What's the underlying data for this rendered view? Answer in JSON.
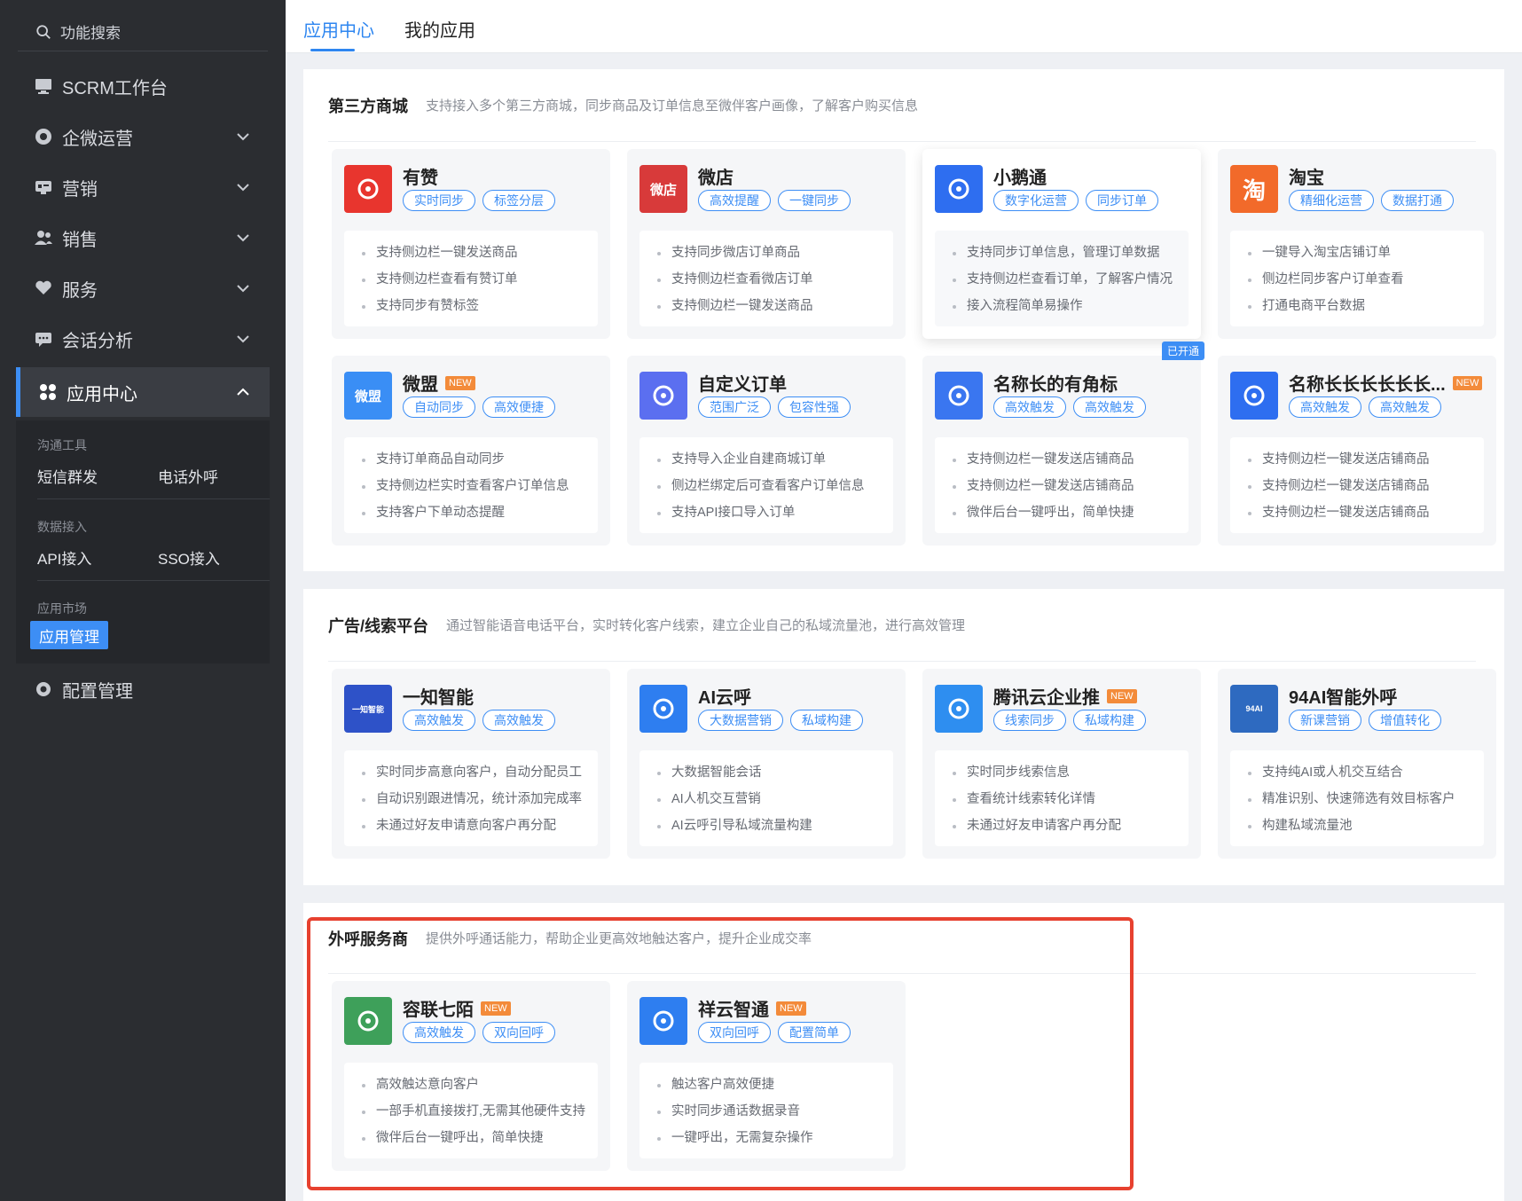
{
  "sidebar": {
    "search_label": "功能搜索",
    "items": [
      {
        "label": "SCRM工作台",
        "icon": "monitor-icon"
      },
      {
        "label": "企微运营",
        "icon": "chat-bubble-icon"
      },
      {
        "label": "营销",
        "icon": "megaphone-icon"
      },
      {
        "label": "销售",
        "icon": "users-icon"
      },
      {
        "label": "服务",
        "icon": "heart-hand-icon"
      },
      {
        "label": "会话分析",
        "icon": "message-icon"
      },
      {
        "label": "应用中心",
        "icon": "apps-grid-icon"
      },
      {
        "label": "配置管理",
        "icon": "gear-icon"
      }
    ],
    "groups": [
      {
        "title": "沟通工具",
        "items": [
          "短信群发",
          "电话外呼"
        ]
      },
      {
        "title": "数据接入",
        "items": [
          "API接入",
          "SSO接入"
        ]
      },
      {
        "title": "应用市场",
        "items": [
          "应用管理"
        ]
      }
    ]
  },
  "tabs": [
    {
      "label": "应用中心"
    },
    {
      "label": "我的应用"
    }
  ],
  "sections": [
    {
      "title": "第三方商城",
      "desc": "支持接入多个第三方商城，同步商品及订单信息至微伴客户画像，了解客户购买信息",
      "cards": [
        {
          "name": "有赞",
          "new": "",
          "opened": "",
          "logo_text": "",
          "logo_color": "#e8352e",
          "tags": [
            "实时同步",
            "标签分层"
          ],
          "features": [
            "支持侧边栏一键发送商品",
            "支持侧边栏查看有赞订单",
            "支持同步有赞标签"
          ]
        },
        {
          "name": "微店",
          "new": "",
          "opened": "",
          "logo_text": "微店",
          "logo_color": "#d83a3a",
          "tags": [
            "高效提醒",
            "一键同步"
          ],
          "features": [
            "支持同步微店订单商品",
            "支持侧边栏查看微店订单",
            "支持侧边栏一键发送商品"
          ]
        },
        {
          "name": "小鹅通",
          "new": "",
          "opened": "",
          "logo_text": "",
          "logo_color": "#2e6ef0",
          "tags": [
            "数字化运营",
            "同步订单"
          ],
          "features": [
            "支持同步订单信息，管理订单数据",
            "支持侧边栏查看订单，了解客户情况",
            "接入流程简单易操作"
          ]
        },
        {
          "name": "淘宝",
          "new": "",
          "opened": "",
          "logo_text": "淘",
          "logo_color": "#f26a2a",
          "tags": [
            "精细化运营",
            "数据打通"
          ],
          "features": [
            "一键导入淘宝店铺订单",
            "侧边栏同步客户订单查看",
            "打通电商平台数据"
          ]
        },
        {
          "name": "微盟",
          "new": "NEW",
          "opened": "",
          "logo_text": "微盟",
          "logo_color": "#3a8ef5",
          "tags": [
            "自动同步",
            "高效便捷"
          ],
          "features": [
            "支持订单商品自动同步",
            "支持侧边栏实时查看客户订单信息",
            "支持客户下单动态提醒"
          ]
        },
        {
          "name": "自定义订单",
          "new": "",
          "opened": "",
          "logo_text": "",
          "logo_color": "#5b6ff0",
          "tags": [
            "范围广泛",
            "包容性强"
          ],
          "features": [
            "支持导入企业自建商城订单",
            "侧边栏绑定后可查看客户订单信息",
            "支持API接口导入订单"
          ]
        },
        {
          "name": "名称长的有角标",
          "new": "",
          "opened": "已开通",
          "logo_text": "",
          "logo_color": "#3a76f0",
          "tags": [
            "高效触发",
            "高效触发"
          ],
          "features": [
            "支持侧边栏一键发送店铺商品",
            "支持侧边栏一键发送店铺商品",
            "微伴后台一键呼出，简单快捷"
          ]
        },
        {
          "name": "名称长长长长长长...",
          "new": "NEW",
          "opened": "",
          "logo_text": "",
          "logo_color": "#2e6ef0",
          "tags": [
            "高效触发",
            "高效触发"
          ],
          "features": [
            "支持侧边栏一键发送店铺商品",
            "支持侧边栏一键发送店铺商品",
            "支持侧边栏一键发送店铺商品"
          ]
        }
      ]
    },
    {
      "title": "广告/线索平台",
      "desc": "通过智能语音电话平台，实时转化客户线索，建立企业自己的私域流量池，进行高效管理",
      "cards": [
        {
          "name": "一知智能",
          "new": "",
          "opened": "",
          "logo_text": "一知智能",
          "logo_color": "#2e52c8",
          "tags": [
            "高效触发",
            "高效触发"
          ],
          "features": [
            "实时同步高意向客户，自动分配员工",
            "自动识别跟进情况，统计添加完成率",
            "未通过好友申请意向客户再分配"
          ]
        },
        {
          "name": "AI云呼",
          "new": "",
          "opened": "",
          "logo_text": "",
          "logo_color": "#2e7ef0",
          "tags": [
            "大数据营销",
            "私域构建"
          ],
          "features": [
            "大数据智能会话",
            "AI人机交互营销",
            "AI云呼引导私域流量构建"
          ]
        },
        {
          "name": "腾讯云企业推",
          "new": "NEW",
          "opened": "",
          "logo_text": "",
          "logo_color": "#2e8ef0",
          "tags": [
            "线索同步",
            "私域构建"
          ],
          "features": [
            "实时同步线索信息",
            "查看统计线索转化详情",
            "未通过好友申请客户再分配"
          ]
        },
        {
          "name": "94AI智能外呼",
          "new": "",
          "opened": "",
          "logo_text": "94AI",
          "logo_color": "#2e6ac0",
          "tags": [
            "新课营销",
            "增值转化"
          ],
          "features": [
            "支持纯AI或人机交互结合",
            "精准识别、快速筛选有效目标客户",
            "构建私域流量池"
          ]
        }
      ]
    },
    {
      "title": "外呼服务商",
      "desc": "提供外呼通话能力，帮助企业更高效地触达客户，提升企业成交率",
      "cards": [
        {
          "name": "容联七陌",
          "new": "NEW",
          "opened": "",
          "logo_text": "",
          "logo_color": "#3ea05a",
          "tags": [
            "高效触发",
            "双向回呼"
          ],
          "features": [
            "高效触达意向客户",
            "一部手机直接拨打,无需其他硬件支持",
            "微伴后台一键呼出，简单快捷"
          ]
        },
        {
          "name": "祥云智通",
          "new": "NEW",
          "opened": "",
          "logo_text": "",
          "logo_color": "#2e7ef0",
          "tags": [
            "双向回呼",
            "配置简单"
          ],
          "features": [
            "触达客户高效便捷",
            "实时同步通话数据录音",
            "一键呼出，无需复杂操作"
          ]
        }
      ]
    }
  ]
}
